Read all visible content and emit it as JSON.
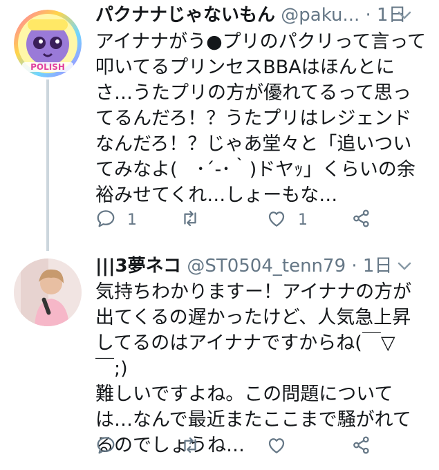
{
  "tweets": [
    {
      "name": "パクナナじゃないもん",
      "handle": "@paku...",
      "time": "· 1日",
      "body": "アイナナがう●プリのパクリって言って叩いてるプリンセスBBAはほんとにさ…うたプリの方が優れてるって思ってるんだろ！？うたプリはレジェンドなんだろ！？じゃあ堂々と「追いついてみなよ(　･´-･｀)ドヤｯ」くらいの余裕みせてくれ…しょーもな…",
      "reply_count": "1",
      "retweet_count": "",
      "like_count": "1",
      "avatar_label": "POLISH"
    },
    {
      "name": "|||3夢ネコ",
      "handle": "@ST0504_tenn79",
      "time": "· 1日",
      "body": "気持ちわかりますー！アイナナの方が出てくるの遅かったけど、人気急上昇してるのはアイナナですからね(￣▽￣;)\n難しいですよね。この問題については…なんで最近またここまで騒がれてるのでしょうね…",
      "reply_count": "",
      "retweet_count": "",
      "like_count": ""
    }
  ]
}
